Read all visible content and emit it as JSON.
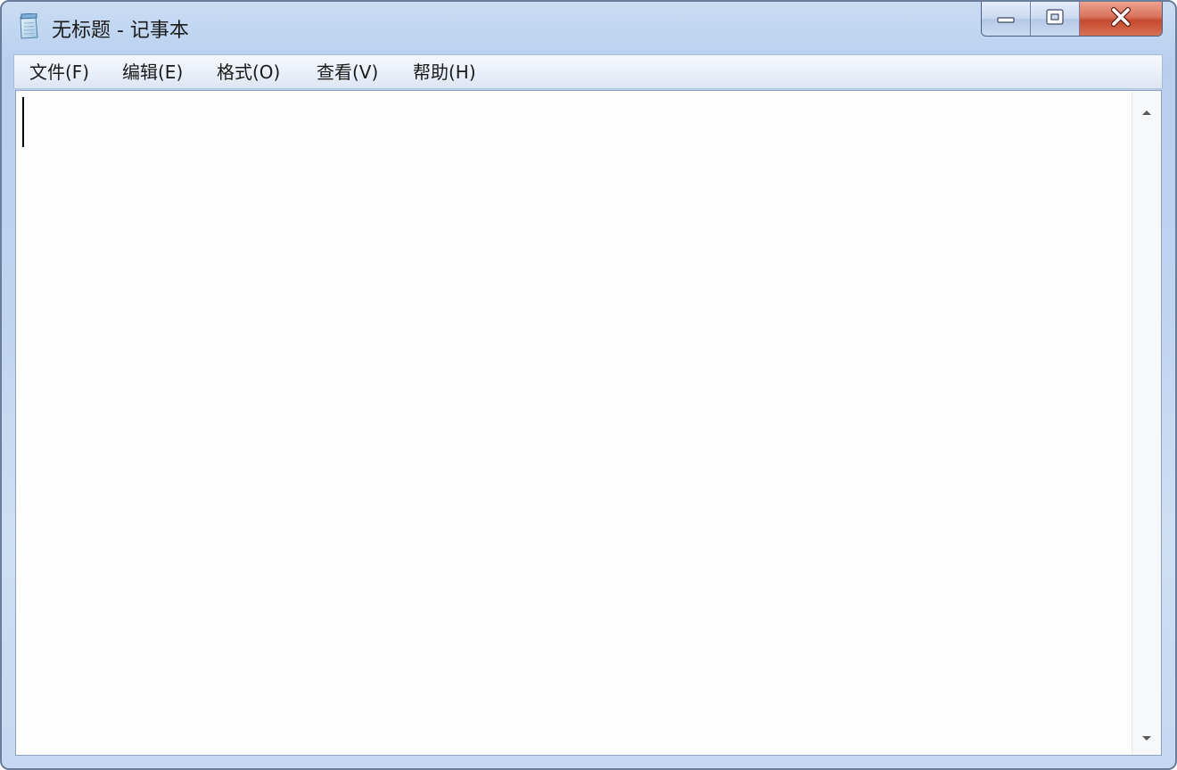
{
  "window": {
    "title": "无标题 - 记事本",
    "app_icon": "notepad-icon"
  },
  "window_controls": {
    "minimize_icon": "minimize-icon",
    "maximize_icon": "maximize-icon",
    "close_icon": "close-icon",
    "close_color": "#c54a2f"
  },
  "menu": {
    "items": [
      {
        "label": "文件(F)"
      },
      {
        "label": "编辑(E)"
      },
      {
        "label": "格式(O)"
      },
      {
        "label": "查看(V)"
      },
      {
        "label": "帮助(H)"
      }
    ]
  },
  "editor": {
    "content": ""
  },
  "scrollbar": {
    "up_icon": "scroll-up-arrow-icon",
    "down_icon": "scroll-down-arrow-icon"
  }
}
